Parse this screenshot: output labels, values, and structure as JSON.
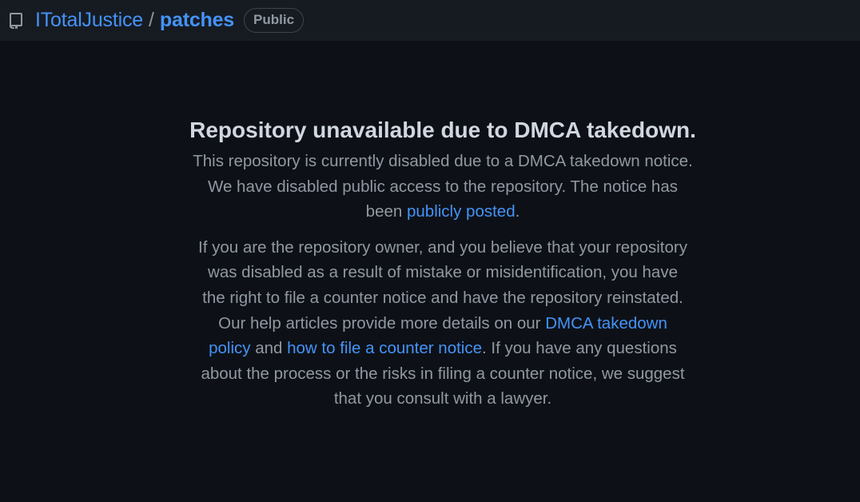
{
  "header": {
    "icon": "repo-icon",
    "owner": "ITotalJustice",
    "separator": "/",
    "repo": "patches",
    "visibility_badge": "Public"
  },
  "notice": {
    "title": "Repository unavailable due to DMCA takedown.",
    "p1_text": "This repository is currently disabled due to a DMCA takedown notice. We have disabled public access to the repository. The notice has been ",
    "p1_link": "publicly posted",
    "p1_end": ".",
    "p2_text_a": "If you are the repository owner, and you believe that your repository was disabled as a result of mistake or misidentification, you have the right to file a counter notice and have the repository reinstated. Our help articles provide more details on our ",
    "p2_link_a": "DMCA takedown policy",
    "p2_text_b": " and ",
    "p2_link_b": "how to file a counter notice",
    "p2_text_c": ". If you have any questions about the process or the risks in filing a counter notice, we suggest that you consult with a lawyer."
  },
  "colors": {
    "background": "#0d1117",
    "header_bg": "#161b22",
    "link": "#4493f8",
    "title": "#d1d7e0",
    "muted_text": "#9198a1"
  }
}
